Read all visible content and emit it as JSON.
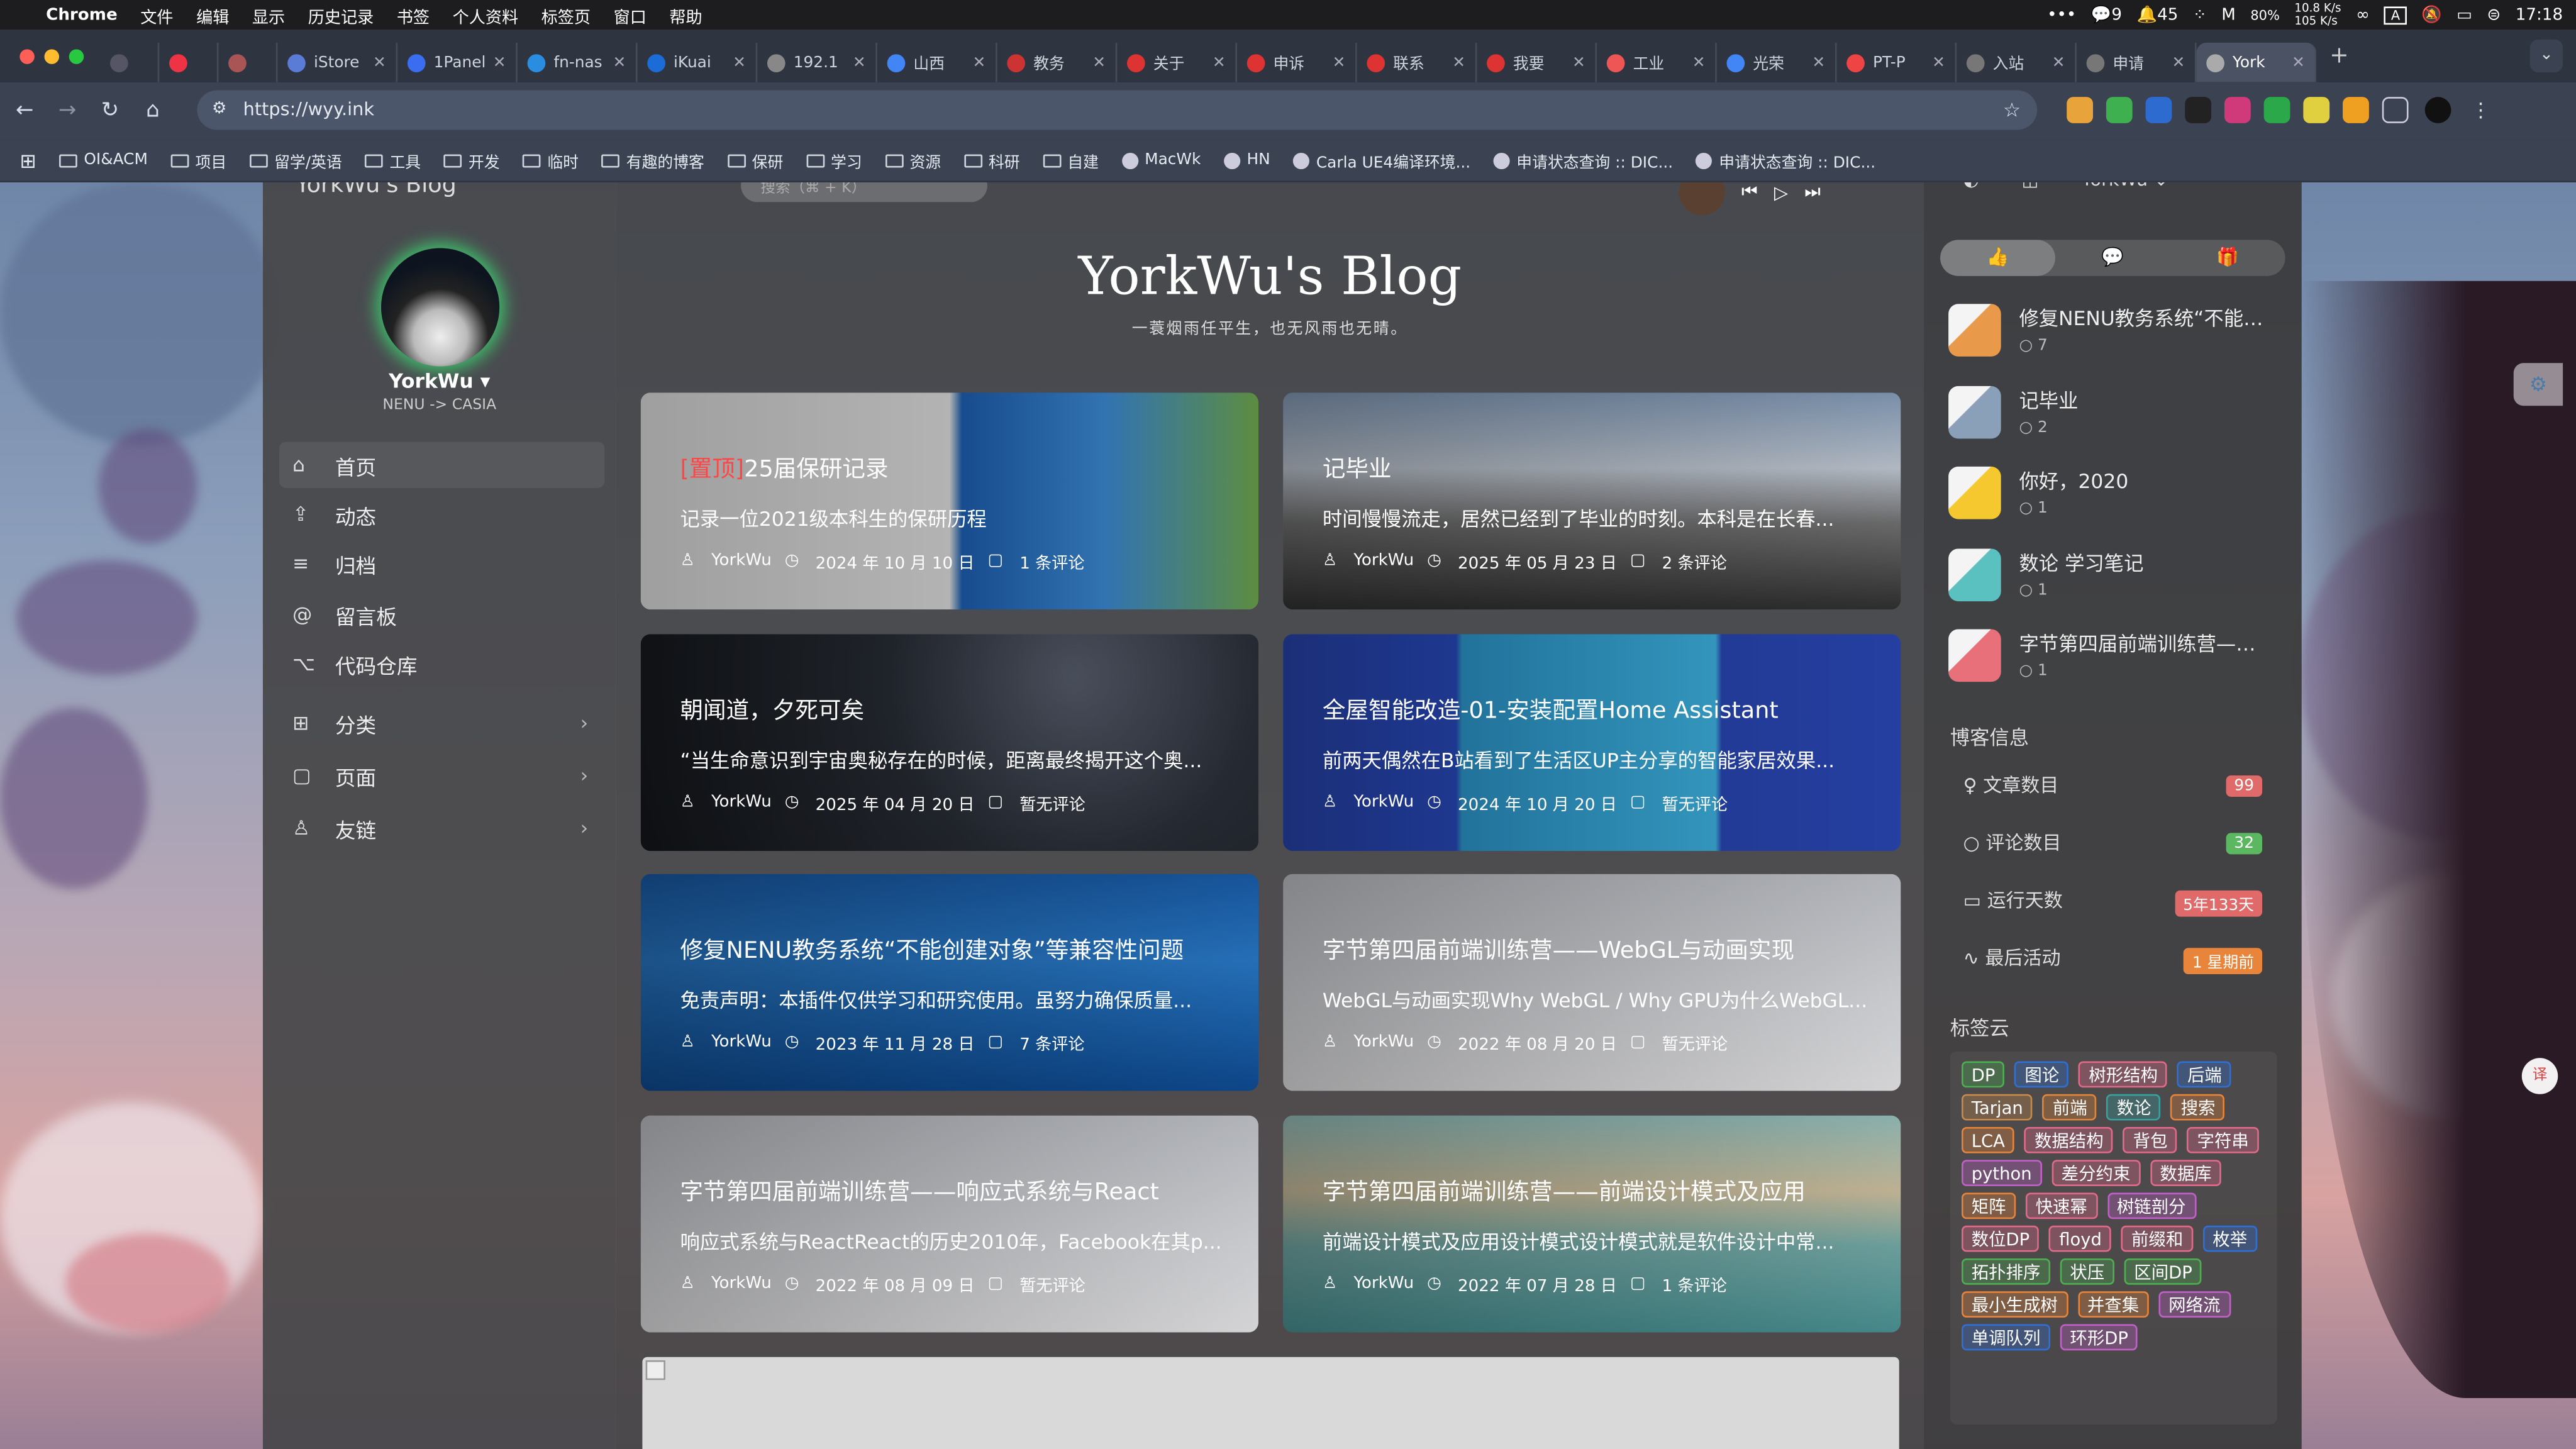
{
  "menubar": {
    "apple": "",
    "app": "Chrome",
    "items": [
      "文件",
      "编辑",
      "显示",
      "历史记录",
      "书签",
      "个人资料",
      "标签页",
      "窗口",
      "帮助"
    ],
    "status": {
      "wechat": "9",
      "notif": "45",
      "battery": "80%",
      "net_up": "10.8 K/s",
      "net_down": "105 K/s",
      "time": "17:18",
      "input": "A"
    }
  },
  "tabs": [
    {
      "title": "",
      "color": "#556"
    },
    {
      "title": "",
      "color": "#e34"
    },
    {
      "title": "",
      "color": "#a55"
    },
    {
      "title": "iStore",
      "color": "#5a7bd6"
    },
    {
      "title": "1Panel",
      "color": "#3a6df0"
    },
    {
      "title": "fn-nas",
      "color": "#2a8de0"
    },
    {
      "title": "iKuai",
      "color": "#1c6cd8"
    },
    {
      "title": "192.1",
      "color": "#888"
    },
    {
      "title": "山西",
      "color": "#4285f4"
    },
    {
      "title": "教务",
      "color": "#c33"
    },
    {
      "title": "关于",
      "color": "#d33"
    },
    {
      "title": "申诉",
      "color": "#d33"
    },
    {
      "title": "联系",
      "color": "#d33"
    },
    {
      "title": "我要",
      "color": "#d33"
    },
    {
      "title": "工业",
      "color": "#e55"
    },
    {
      "title": "光荣",
      "color": "#4285f4"
    },
    {
      "title": "PT-P",
      "color": "#e44"
    },
    {
      "title": "入站",
      "color": "#777"
    },
    {
      "title": "申请",
      "color": "#777"
    },
    {
      "title": "York",
      "color": "#aaa",
      "active": true
    }
  ],
  "address": {
    "url": "https://wyy.ink"
  },
  "bookmarks": [
    "OI&ACM",
    "项目",
    "留学/英语",
    "工具",
    "开发",
    "临时",
    "有趣的博客",
    "保研",
    "学习",
    "资源",
    "科研",
    "自建",
    "MacWk",
    "HN",
    "Carla UE4编译环境...",
    "申请状态查询 :: DIC...",
    "申请状态查询 :: DIC..."
  ],
  "blog": {
    "site_title": "YorkWu's Blog",
    "search_placeholder": "搜索（⌘ + K）",
    "title": "YorkWu's Blog",
    "subtitle": "一蓑烟雨任平生，也无风雨也无晴。",
    "user": {
      "name": "YorkWu",
      "sub": "NENU -> CASIA",
      "top_name": "YorkWu"
    },
    "nav": [
      {
        "label": "首页",
        "icon": "home-icon",
        "glyph": "⌂"
      },
      {
        "label": "动态",
        "icon": "share-icon",
        "glyph": "⇪"
      },
      {
        "label": "归档",
        "icon": "list-icon",
        "glyph": "≡"
      },
      {
        "label": "留言板",
        "icon": "at-icon",
        "glyph": "@"
      },
      {
        "label": "代码仓库",
        "icon": "github-icon",
        "glyph": "⌥"
      },
      {
        "label": "分类",
        "icon": "grid-icon",
        "glyph": "⊞",
        "arrow": "›"
      },
      {
        "label": "页面",
        "icon": "page-icon",
        "glyph": "▢",
        "arrow": "›"
      },
      {
        "label": "友链",
        "icon": "user-icon",
        "glyph": "♙",
        "arrow": "›"
      }
    ],
    "posts": [
      {
        "pin": "[置顶]",
        "title": "25届保研记录",
        "desc": "记录一位2021级本科生的保研历程",
        "author": "YorkWu",
        "date": "2024 年 10 月 10 日",
        "comments": "1 条评论",
        "bg": "linear-gradient(90deg,#f4f4f4 0%,#eaeaea 50%,#1e63b8 52%,#3c8cd8 75%,#6aa04a 100%)"
      },
      {
        "pin": "",
        "title": "记毕业",
        "desc": "时间慢慢流走，居然已经到了毕业的时刻。本科是在长春...",
        "author": "YorkWu",
        "date": "2025 年 05 月 23 日",
        "comments": "2 条评论",
        "bg": "linear-gradient(180deg,#8aa2c0 0%,#c9d1dc 35%,#777 60%,#333 100%)"
      },
      {
        "pin": "",
        "title": "朝闻道，夕死可矣",
        "desc": "“当生命意识到宇宙奥秘存在的时候，距离最终揭开这个奥...",
        "author": "YorkWu",
        "date": "2025 年 04 月 20 日",
        "comments": "暂无评论",
        "bg": "radial-gradient(circle at 70% 20%,#5a6070 0%,#2a2f38 40%,#15181d 100%)"
      },
      {
        "pin": "",
        "title": "全屋智能改造-01-安装配置Home Assistant",
        "desc": "前两天偶然在B站看到了生活区UP主分享的智能家居效果...",
        "author": "YorkWu",
        "date": "2024 年 10 月 20 日",
        "comments": "暂无评论",
        "bg": "linear-gradient(90deg,#2a48b8 0%,#2a4ec8 28%,#2fa0d8 29%,#3fb8e8 70%,#2a48b8 71%,#2a48b8 100%)"
      },
      {
        "pin": "",
        "title": "修复NENU教务系统“不能创建对象”等兼容性问题",
        "desc": "免责声明：本插件仅供学习和研究使用。虽努力确保质量...",
        "author": "YorkWu",
        "date": "2023 年 11 月 28 日",
        "comments": "7 条评论",
        "bg": "linear-gradient(180deg,#1a5fae 0%,#2a7ed0 40%,#0f4f9a 100%)"
      },
      {
        "pin": "",
        "title": "字节第四届前端训练营——WebGL与动画实现",
        "desc": "WebGL与动画实现Why WebGL / Why GPU为什么WebGL...",
        "author": "YorkWu",
        "date": "2022 年 08 月 20 日",
        "comments": "暂无评论",
        "bg": "linear-gradient(180deg,#c9ccd2 0%,#e2e4e8 55%,#f1f1f3 100%)"
      },
      {
        "pin": "",
        "title": "字节第四届前端训练营——响应式系统与React",
        "desc": "响应式系统与ReactReact的历史2010年，Facebook在其p...",
        "author": "YorkWu",
        "date": "2022 年 08 月 09 日",
        "comments": "暂无评论",
        "bg": "linear-gradient(180deg,#c9ccd2 0%,#e2e4e8 55%,#f1f1f3 100%)"
      },
      {
        "pin": "",
        "title": "字节第四届前端训练营——前端设计模式及应用",
        "desc": "前端设计模式及应用设计模式设计模式就是软件设计中常...",
        "author": "YorkWu",
        "date": "2022 年 07 月 28 日",
        "comments": "1 条评论",
        "bg": "linear-gradient(180deg,#9cc8c4 0%,#d8c9a6 35%,#7ab3b0 60%,#4e9a9c 100%)"
      }
    ],
    "right_tabs": [
      "👍",
      "💬",
      "🎁"
    ],
    "hot": [
      {
        "title": "修复NENU教务系统“不能创建对象”等兼容性问题",
        "count": "7",
        "color": "#e89a4a"
      },
      {
        "title": "记毕业",
        "count": "2",
        "color": "#8aa0b8"
      },
      {
        "title": "你好，2020",
        "count": "1",
        "color": "#f5c830"
      },
      {
        "title": "数论 学习笔记",
        "count": "1",
        "color": "#5ac0c0"
      },
      {
        "title": "字节第四届前端训练营——WebGL与动画实现",
        "count": "1",
        "color": "#e8707a"
      }
    ],
    "info_title": "博客信息",
    "stats": [
      {
        "label": "文章数目",
        "value": "99",
        "color": "#e06a6a",
        "glyph": "♀"
      },
      {
        "label": "评论数目",
        "value": "32",
        "color": "#5cb860",
        "glyph": "○"
      },
      {
        "label": "运行天数",
        "value": "5年133天",
        "color": "#e06a6a",
        "glyph": "▭"
      },
      {
        "label": "最后活动",
        "value": "1 星期前",
        "color": "#e8853a",
        "glyph": "∿"
      }
    ],
    "tags_title": "标签云",
    "tags": [
      {
        "t": "DP",
        "bg": "#4caf50"
      },
      {
        "t": "图论",
        "bg": "#2f6fd6"
      },
      {
        "t": "树形结构",
        "bg": "#e2698a"
      },
      {
        "t": "后端",
        "bg": "#2f6fd6"
      },
      {
        "t": "Tarjan",
        "bg": "#c88a4a"
      },
      {
        "t": "前端",
        "bg": "#e0863a"
      },
      {
        "t": "数论",
        "bg": "#3aa0a0"
      },
      {
        "t": "搜索",
        "bg": "#e8843a"
      },
      {
        "t": "LCA",
        "bg": "#e8843a"
      },
      {
        "t": "数据结构",
        "bg": "#e2698a"
      },
      {
        "t": "背包",
        "bg": "#e2698a"
      },
      {
        "t": "字符串",
        "bg": "#e2698a"
      },
      {
        "t": "python",
        "bg": "#c060c8"
      },
      {
        "t": "差分约束",
        "bg": "#e2698a"
      },
      {
        "t": "数据库",
        "bg": "#e2698a"
      },
      {
        "t": "矩阵",
        "bg": "#e8843a"
      },
      {
        "t": "快速幂",
        "bg": "#e2698a"
      },
      {
        "t": "树链剖分",
        "bg": "#c060c8"
      },
      {
        "t": "数位DP",
        "bg": "#e2698a"
      },
      {
        "t": "floyd",
        "bg": "#e2698a"
      },
      {
        "t": "前缀和",
        "bg": "#e2698a"
      },
      {
        "t": "枚举",
        "bg": "#2f6fd6"
      },
      {
        "t": "拓扑排序",
        "bg": "#4caf50"
      },
      {
        "t": "状压",
        "bg": "#4caf50"
      },
      {
        "t": "区间DP",
        "bg": "#4caf50"
      },
      {
        "t": "最小生成树",
        "bg": "#e8843a"
      },
      {
        "t": "并查集",
        "bg": "#e8843a"
      },
      {
        "t": "网络流",
        "bg": "#c060c8"
      },
      {
        "t": "单调队列",
        "bg": "#2f6fd6"
      },
      {
        "t": "环形DP",
        "bg": "#c060c8"
      }
    ]
  }
}
